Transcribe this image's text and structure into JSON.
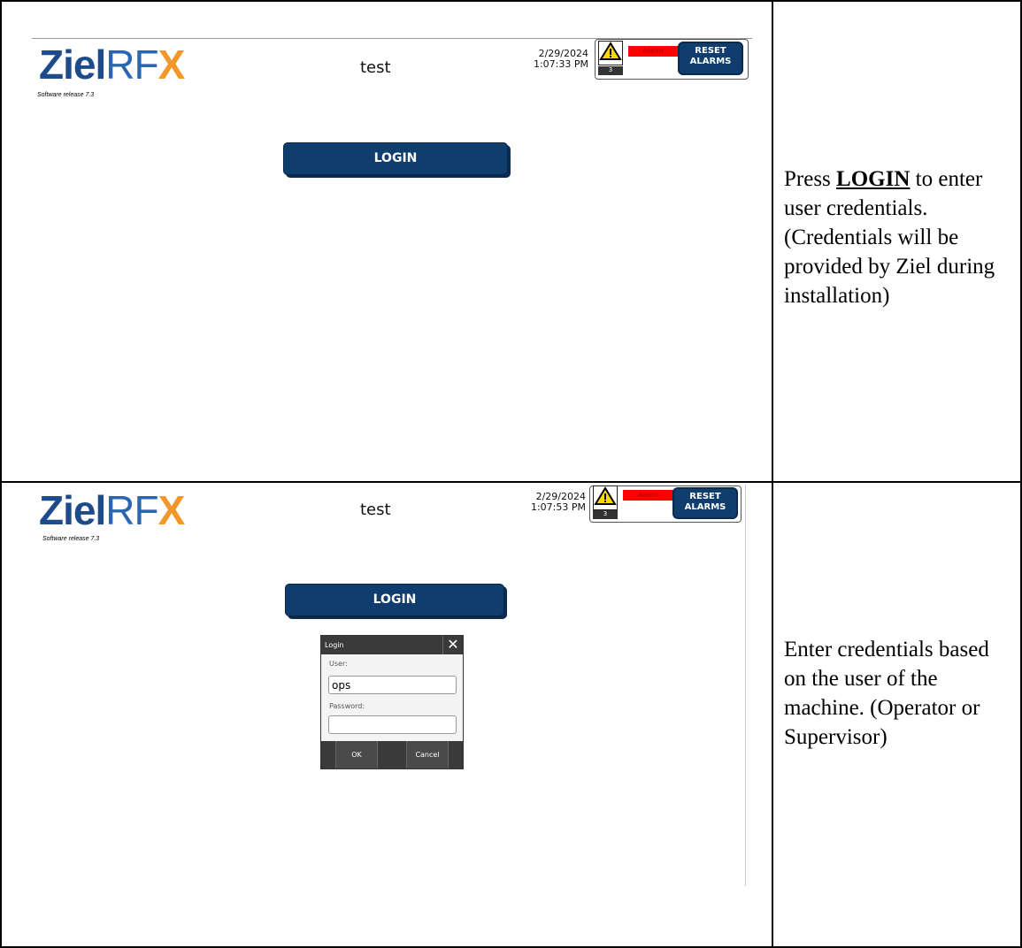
{
  "screens": [
    {
      "logo": {
        "ziel": "Ziel",
        "rf": "RF",
        "x": "X"
      },
      "release": "Software release  7.3",
      "title": "test",
      "date": "2/29/2024",
      "time": "1:07:33 PM",
      "alarm_count": "3",
      "alarm_label": "Alarm",
      "reset_label_line1": "RESET",
      "reset_label_line2": "ALARMS",
      "login_label": "LOGIN",
      "description_prefix": "Press ",
      "description_bold": "LOGIN",
      "description_rest": " to enter user credentials. (Credentials will be provided by Ziel during installation)"
    },
    {
      "logo": {
        "ziel": "Ziel",
        "rf": "RF",
        "x": "X"
      },
      "release": "Software release  7.3",
      "title": "test",
      "date": "2/29/2024",
      "time": "1:07:53 PM",
      "alarm_count": "3",
      "alarm_label": "Alarm",
      "reset_label_line1": "RESET",
      "reset_label_line2": "ALARMS",
      "login_label": "LOGIN",
      "dialog": {
        "title": "Login",
        "close": "✕",
        "user_label": "User:",
        "user_value": "ops",
        "password_label": "Password:",
        "password_value": "",
        "ok_label": "OK",
        "cancel_label": "Cancel"
      },
      "description": "Enter credentials based on the user of the machine. (Operator or Supervisor)"
    }
  ],
  "colors": {
    "brand_blue": "#1e4b8a",
    "brand_orange": "#f4962a",
    "button_blue": "#0f3d6e",
    "alarm_red": "#ff0000"
  }
}
